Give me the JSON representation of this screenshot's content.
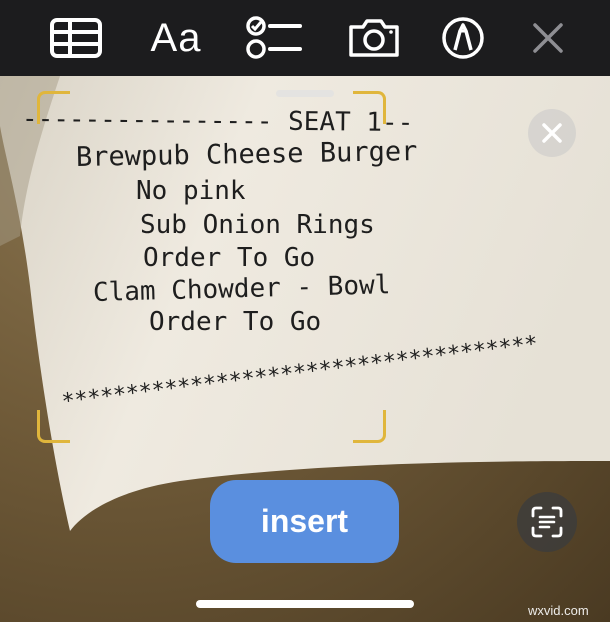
{
  "toolbar": {
    "items": [
      {
        "name": "table-icon",
        "label": ""
      },
      {
        "name": "text-format-icon",
        "label": "Aa"
      },
      {
        "name": "checklist-icon",
        "label": ""
      },
      {
        "name": "camera-icon",
        "label": ""
      },
      {
        "name": "markup-pen-icon",
        "label": ""
      },
      {
        "name": "close-icon",
        "label": ""
      }
    ]
  },
  "receipt": {
    "seat_header": "---------------- SEAT 1--",
    "lines": [
      "Brewpub Cheese Burger",
      "No pink",
      "Sub Onion Rings",
      "Order To Go",
      "Clam Chowder - Bowl",
      "Order To Go"
    ],
    "stars": "*************************************"
  },
  "actions": {
    "insert_label": "insert",
    "scan_icon": "live-text-scan-icon",
    "dismiss_icon": "close-circle-icon"
  },
  "watermark": "wxvid.com",
  "colors": {
    "toolbar_bg": "#1c1c1e",
    "insert_bg": "#5a8fdf",
    "bracket": "#e0b63c",
    "paper": "#ece7dc"
  }
}
